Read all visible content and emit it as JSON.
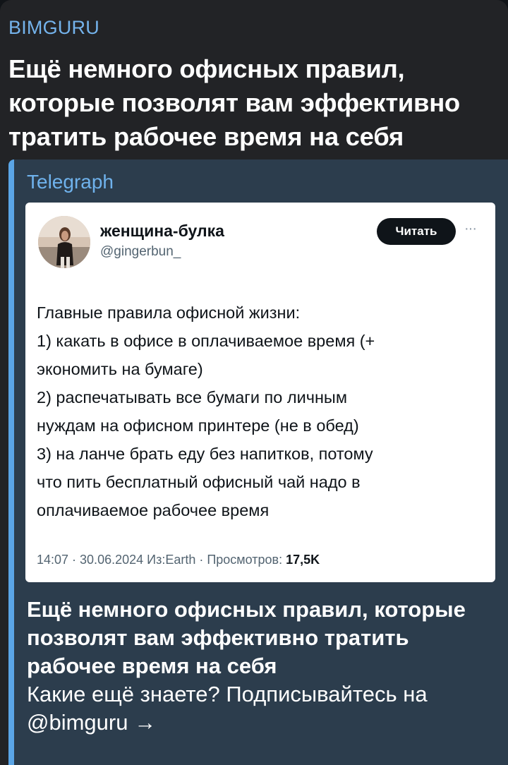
{
  "channel": {
    "name": "BIMGURU"
  },
  "post": {
    "title": "Ещё немного офисных правил, которые позволят вам эффективно тратить рабочее время на себя"
  },
  "preview": {
    "site_name": "Telegraph",
    "tweet": {
      "display_name": "женщина-булка",
      "handle": "@gingerbun_",
      "follow_label": "Читать",
      "more_icon": "ellipsis-icon",
      "lines": [
        "Главные правила офисной жизни:",
        "1) какать в офисе в оплачиваемое время (+",
        "экономить на бумаге)",
        "2) распечатывать все бумаги по личным",
        "нуждам на офисном принтере (не в обед)",
        "3) на ланче брать еду без напитков, потому",
        "что пить бесплатный офисный чай надо в",
        "оплачиваемое рабочее время"
      ],
      "meta": "14:07 · 30.06.2024 Из:Earth · Просмотров:",
      "views": "17,5K"
    },
    "description_title": "Ещё немного офисных правил, которые позволят вам эффективно тратить рабочее время на себя",
    "description_text": "Какие ещё знаете? Подписывайтесь на @bimguru →"
  },
  "colors": {
    "background": "#222326",
    "channel_name": "#74b3ec",
    "preview_bg": "#2c3d4d",
    "preview_accent": "#5aa5e6"
  }
}
